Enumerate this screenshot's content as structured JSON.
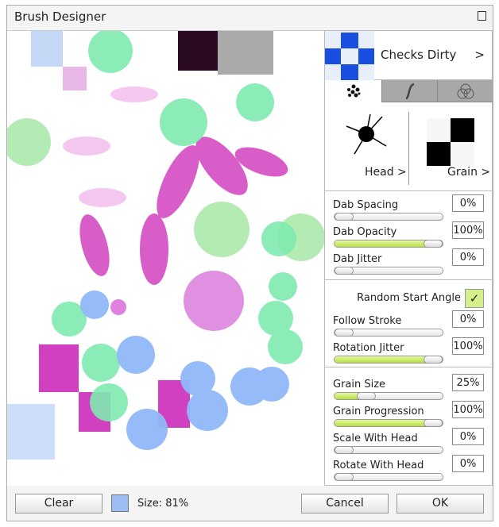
{
  "window": {
    "title": "Brush Designer",
    "menu_icon": "list-icon"
  },
  "brush": {
    "name": "Checks Dirty",
    "arrow": ">"
  },
  "tabs": [
    {
      "icon": "dabs-icon",
      "active": true
    },
    {
      "icon": "stroke-curve-icon"
    },
    {
      "icon": "color-circles-icon"
    }
  ],
  "head": {
    "label": "Head >"
  },
  "grain": {
    "label": "Grain >"
  },
  "sliders": [
    {
      "label": "Dab Spacing",
      "value": "0%",
      "level": 0
    },
    {
      "label": "Dab Opacity",
      "value": "100%",
      "level": 100
    },
    {
      "label": "Dab Jitter",
      "value": "0%",
      "level": 0
    },
    {
      "label": "Follow Stroke",
      "value": "0%",
      "level": 0
    },
    {
      "label": "Rotation Jitter",
      "value": "100%",
      "level": 100
    },
    {
      "label": "Grain Size",
      "value": "25%",
      "level": 25
    },
    {
      "label": "Grain Progression",
      "value": "100%",
      "level": 100
    },
    {
      "label": "Scale With Head",
      "value": "0%",
      "level": 0
    },
    {
      "label": "Rotate With Head",
      "value": "0%",
      "level": 0
    }
  ],
  "random_start_angle": {
    "label": "Random Start Angle",
    "checked": true,
    "mark": "✓"
  },
  "footer": {
    "clear": "Clear",
    "size": "Size: 81%",
    "cancel": "Cancel",
    "ok": "OK",
    "color": "#9dbdf5"
  }
}
